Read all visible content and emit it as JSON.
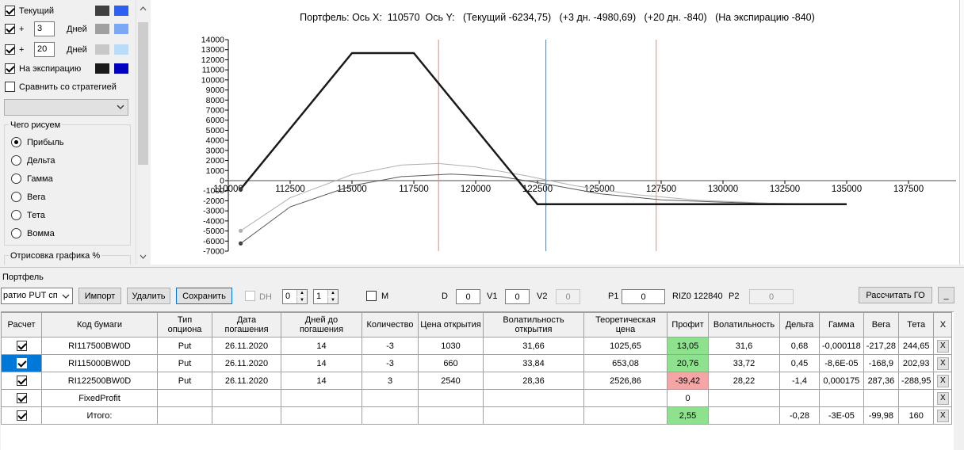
{
  "left_panel": {
    "rows": [
      {
        "label": "Текущий",
        "checked": true,
        "color_a": "#404040",
        "color_b": "#2e5ff0"
      },
      {
        "prefix": "+",
        "days": "3",
        "label": "Дней",
        "checked": true,
        "color_a": "#a0a0a0",
        "color_b": "#7aa8f5"
      },
      {
        "prefix": "+",
        "days": "20",
        "label": "Дней",
        "checked": true,
        "color_a": "#c8c8c8",
        "color_b": "#b8dcfa"
      },
      {
        "label": "На экспирацию",
        "checked": true,
        "color_a": "#1a1a1a",
        "color_b": "#0000c0"
      }
    ],
    "compare_label": "Сравнить со стратегией",
    "compare_checked": false,
    "strategy_select_value": "",
    "draw_group_title": "Чего рисуем",
    "draw_options": [
      {
        "label": "Прибыль",
        "selected": true
      },
      {
        "label": "Дельта",
        "selected": false
      },
      {
        "label": "Гамма",
        "selected": false
      },
      {
        "label": "Вега",
        "selected": false
      },
      {
        "label": "Тета",
        "selected": false
      },
      {
        "label": "Вомма",
        "selected": false
      }
    ],
    "render_group_title": "Отрисовка графика %"
  },
  "chart": {
    "header": "Портфель: Ось X:  110570  Ось Y:   (Текущий -6234,75)   (+3 дн. -4980,69)   (+20 дн. -840)   (На экспирацию -840)"
  },
  "chart_data": {
    "type": "line",
    "xlim": [
      110000,
      137500
    ],
    "ylim": [
      -7000,
      14000
    ],
    "x_ticks": [
      "110000",
      "112500",
      "115000",
      "117500",
      "120000",
      "122500",
      "125000",
      "127500",
      "130000",
      "132500",
      "135000",
      "137500"
    ],
    "y_ticks": [
      "14000",
      "13000",
      "12000",
      "11000",
      "10000",
      "9000",
      "8000",
      "7000",
      "6000",
      "5000",
      "4000",
      "3000",
      "2000",
      "1000",
      "0",
      "-1000",
      "-2000",
      "-3000",
      "-4000",
      "-5000",
      "-6000",
      "-7000"
    ],
    "vertical_markers": [
      {
        "x": 118500,
        "color": "#f08080"
      },
      {
        "x": 122840,
        "color": "#5a7aa8"
      },
      {
        "x": 127300,
        "color": "#f08080"
      }
    ],
    "series": [
      {
        "color": "#1a1a1a",
        "width": 2.5,
        "points": [
          [
            110500,
            -840
          ],
          [
            115000,
            12660
          ],
          [
            117500,
            12660
          ],
          [
            122500,
            -2340
          ],
          [
            135000,
            -2340
          ]
        ]
      },
      {
        "color": "#5a5a5a",
        "width": 1,
        "points": [
          [
            110500,
            -6235
          ],
          [
            112500,
            -2600
          ],
          [
            115000,
            -500
          ],
          [
            117000,
            400
          ],
          [
            119000,
            650
          ],
          [
            121000,
            400
          ],
          [
            123000,
            -400
          ],
          [
            125000,
            -1300
          ],
          [
            127500,
            -1900
          ],
          [
            130000,
            -2150
          ],
          [
            132500,
            -2280
          ],
          [
            135000,
            -2330
          ]
        ]
      },
      {
        "color": "#b0b0b0",
        "width": 1,
        "points": [
          [
            110500,
            -4981
          ],
          [
            112500,
            -1700
          ],
          [
            115000,
            600
          ],
          [
            117000,
            1550
          ],
          [
            118500,
            1700
          ],
          [
            120000,
            1350
          ],
          [
            122000,
            500
          ],
          [
            124000,
            -500
          ],
          [
            126500,
            -1400
          ],
          [
            129000,
            -1950
          ],
          [
            132000,
            -2250
          ],
          [
            135000,
            -2330
          ]
        ]
      }
    ],
    "endpoint_dots": [
      [
        110500,
        -840
      ],
      [
        110500,
        -6235
      ],
      [
        110500,
        -4981
      ]
    ]
  },
  "portfolio": {
    "title": "Портфель",
    "strategy_select": "ратио PUT сп",
    "import_label": "Импорт",
    "delete_label": "Удалить",
    "save_label": "Сохранить",
    "dh_label": "DH",
    "spin1": "0",
    "spin2": "1",
    "m_label": "M",
    "d_label": "D",
    "d_value": "0",
    "v1_label": "V1",
    "v1_value": "0",
    "v2_label": "V2",
    "v2_value": "0",
    "p1_label": "P1",
    "p1_value": "0",
    "futures_label": "RIZ0 122840",
    "p2_label": "P2",
    "p2_value": "0",
    "calc_go_label": "Рассчитать ГО",
    "minimize_label": "_"
  },
  "grid": {
    "columns": [
      "Расчет",
      "Код бумаги",
      "Тип опциона",
      "Дата погашения",
      "Дней до погашения",
      "Количество",
      "Цена открытия",
      "Волатильность открытия",
      "Теоретическая цена",
      "Профит",
      "Волатильность",
      "Дельта",
      "Гамма",
      "Вега",
      "Тета",
      "X"
    ],
    "rows": [
      {
        "checked": true,
        "code": "RI117500BW0D",
        "type": "Put",
        "date": "26.11.2020",
        "days": "14",
        "qty": "-3",
        "price": "1030",
        "vol_open": "31,66",
        "theo": "1025,65",
        "profit": "13,05",
        "profit_state": "pos",
        "vol": "31,6",
        "delta": "0,68",
        "gamma": "-0,000118",
        "vega": "-217,28",
        "theta": "244,65",
        "x": "X"
      },
      {
        "checked": true,
        "selected": true,
        "code": "RI115000BW0D",
        "type": "Put",
        "date": "26.11.2020",
        "days": "14",
        "qty": "-3",
        "price": "660",
        "vol_open": "33,84",
        "theo": "653,08",
        "profit": "20,76",
        "profit_state": "pos",
        "vol": "33,72",
        "delta": "0,45",
        "gamma": "-8,6E-05",
        "vega": "-168,9",
        "theta": "202,93",
        "x": "X"
      },
      {
        "checked": true,
        "code": "RI122500BW0D",
        "type": "Put",
        "date": "26.11.2020",
        "days": "14",
        "qty": "3",
        "price": "2540",
        "vol_open": "28,36",
        "theo": "2526,86",
        "profit": "-39,42",
        "profit_state": "neg",
        "vol": "28,22",
        "delta": "-1,4",
        "gamma": "0,000175",
        "vega": "287,36",
        "theta": "-288,95",
        "x": "X"
      },
      {
        "checked": true,
        "code": "FixedProfit",
        "type": "",
        "date": "",
        "days": "",
        "qty": "",
        "price": "",
        "vol_open": "",
        "theo": "",
        "profit": "0",
        "profit_state": "",
        "vol": "",
        "delta": "",
        "gamma": "",
        "vega": "",
        "theta": "",
        "x": "X"
      },
      {
        "checked": true,
        "code": "Итого:",
        "type": "",
        "date": "",
        "days": "",
        "qty": "",
        "price": "",
        "vol_open": "",
        "theo": "",
        "profit": "2,55",
        "profit_state": "pos",
        "vol": "",
        "delta": "-0,28",
        "gamma": "-3E-05",
        "vega": "-99,98",
        "theta": "160",
        "x": "X"
      }
    ]
  }
}
